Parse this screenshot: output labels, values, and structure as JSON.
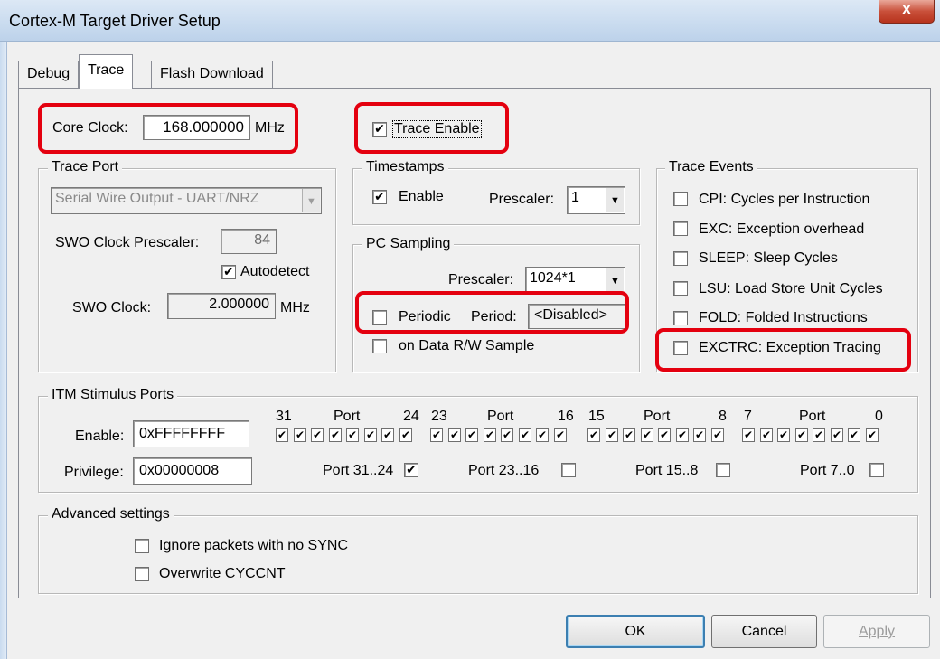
{
  "window": {
    "title": "Cortex-M Target Driver Setup",
    "close_glyph": "X"
  },
  "tabs": [
    {
      "label": "Debug",
      "active": false
    },
    {
      "label": "Trace",
      "active": true
    },
    {
      "label": "Flash Download",
      "active": false
    }
  ],
  "core_clock": {
    "label": "Core Clock:",
    "value": "168.000000",
    "unit": "MHz"
  },
  "trace_enable": {
    "label": "Trace Enable",
    "checked": true
  },
  "trace_port": {
    "legend": "Trace Port",
    "mode": "Serial Wire Output - UART/NRZ",
    "swo_prescaler_label": "SWO Clock Prescaler:",
    "swo_prescaler_value": "84",
    "autodetect_label": "Autodetect",
    "autodetect_checked": true,
    "swo_clock_label": "SWO Clock:",
    "swo_clock_value": "2.000000",
    "swo_clock_unit": "MHz"
  },
  "timestamps": {
    "legend": "Timestamps",
    "enable_label": "Enable",
    "enable_checked": true,
    "prescaler_label": "Prescaler:",
    "prescaler_value": "1"
  },
  "pc_sampling": {
    "legend": "PC Sampling",
    "prescaler_label": "Prescaler:",
    "prescaler_value": "1024*1",
    "periodic_label": "Periodic",
    "periodic_checked": false,
    "period_label": "Period:",
    "period_value": "<Disabled>",
    "data_rw_label": "on Data R/W Sample",
    "data_rw_checked": false
  },
  "trace_events": {
    "legend": "Trace Events",
    "items": [
      {
        "label": "CPI: Cycles per Instruction",
        "checked": false
      },
      {
        "label": "EXC: Exception overhead",
        "checked": false
      },
      {
        "label": "SLEEP: Sleep Cycles",
        "checked": false
      },
      {
        "label": "LSU: Load Store Unit Cycles",
        "checked": false
      },
      {
        "label": "FOLD: Folded Instructions",
        "checked": false
      },
      {
        "label": "EXCTRC: Exception Tracing",
        "checked": false
      }
    ]
  },
  "itm": {
    "legend": "ITM Stimulus Ports",
    "enable_label": "Enable:",
    "enable_value": "0xFFFFFFFF",
    "privilege_label": "Privilege:",
    "privilege_value": "0x00000008",
    "groups": [
      {
        "hi": "31",
        "port": "Port",
        "lo": "24",
        "priv_label": "Port 31..24",
        "priv_checked": true
      },
      {
        "hi": "23",
        "port": "Port",
        "lo": "16",
        "priv_label": "Port 23..16",
        "priv_checked": false
      },
      {
        "hi": "15",
        "port": "Port",
        "lo": "8",
        "priv_label": "Port 15..8",
        "priv_checked": false
      },
      {
        "hi": "7",
        "port": "Port",
        "lo": "0",
        "priv_label": "Port 7..0",
        "priv_checked": false
      }
    ],
    "bits_checked": 32
  },
  "advanced": {
    "legend": "Advanced settings",
    "ignore_label": "Ignore packets with no SYNC",
    "ignore_checked": false,
    "overwrite_label": "Overwrite CYCCNT",
    "overwrite_checked": false
  },
  "buttons": {
    "ok": "OK",
    "cancel": "Cancel",
    "apply": "Apply"
  },
  "check_glyph": "✔",
  "dropdown_glyph": "▼",
  "highlight_color": "#e4000f"
}
